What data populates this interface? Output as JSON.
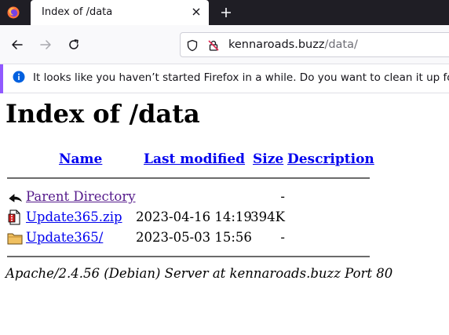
{
  "tab": {
    "title": "Index of /data"
  },
  "urlbar": {
    "host": "kennaroads.buzz",
    "path": "/data/"
  },
  "notification": {
    "message": "It looks like you haven’t started Firefox in a while. Do you want to clean it up for"
  },
  "page": {
    "heading": "Index of /data",
    "columns": {
      "name": "Name",
      "last_modified": "Last modified",
      "size": "Size",
      "description": "Description"
    },
    "rows": [
      {
        "icon": "back-icon",
        "name": "Parent Directory",
        "modified": "",
        "size": "-"
      },
      {
        "icon": "compressed-file-icon",
        "name": "Update365.zip",
        "modified": "2023-04-16 14:19",
        "size": "394K"
      },
      {
        "icon": "folder-icon",
        "name": "Update365/",
        "modified": "2023-05-03 15:56",
        "size": "-"
      }
    ],
    "address": "Apache/2.4.56 (Debian) Server at kennaroads.buzz Port 80"
  },
  "colors": {
    "link": "#0000ee",
    "visited_link": "#551a8b",
    "notification_accent": "#9059ff",
    "tabstrip": "#1f1e25"
  }
}
